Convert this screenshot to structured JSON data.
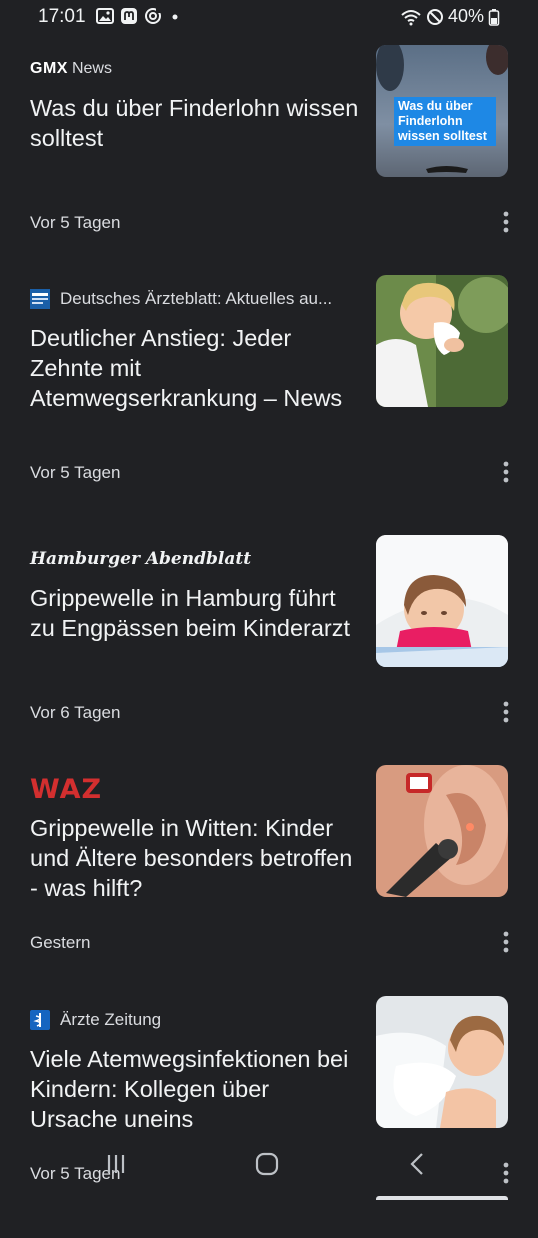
{
  "status_bar": {
    "time": "17:01",
    "battery": "40%",
    "left_icons": [
      "gallery-icon",
      "mastodon-icon",
      "sync-icon",
      "dot-icon"
    ],
    "right_icons": [
      "wifi-icon",
      "do-not-disturb-icon",
      "battery-icon"
    ]
  },
  "articles": [
    {
      "source": "News",
      "source_logo": "GMX",
      "headline": "Was du über Finderlohn wissen solltest",
      "age": "Vor 5 Tagen",
      "thumb_caption": "Was du über Finderlohn wissen solltest"
    },
    {
      "source": "Deutsches Ärzteblatt: Aktuelles au...",
      "source_logo": "aerzteblatt.de",
      "headline": "Deutlicher Anstieg: Jeder Zehnte mit Atemwegserkrankung – News",
      "age": "Vor 5 Tagen"
    },
    {
      "source": "Hamburger Abendblatt",
      "headline": "Grippewelle in Hamburg führt zu Engpässen beim Kinderarzt",
      "age": "Vor 6 Tagen"
    },
    {
      "source": "WAZ",
      "headline": "Grippewelle in Witten: Kinder und Ältere besonders betroffen - was hilft?",
      "age": "Gestern"
    },
    {
      "source": "Ärzte Zeitung",
      "headline": "Viele Atemwegsinfektionen bei Kindern: Kollegen über Ursache uneins",
      "age": "Vor 5 Tagen"
    }
  ],
  "nav_bar": {
    "buttons": [
      "recent-apps-icon",
      "home-icon",
      "back-icon"
    ]
  },
  "colors": {
    "background": "#202124",
    "text_primary": "#f1f3f4",
    "text_secondary": "#dadce0",
    "waz_red": "#d32f2f"
  }
}
